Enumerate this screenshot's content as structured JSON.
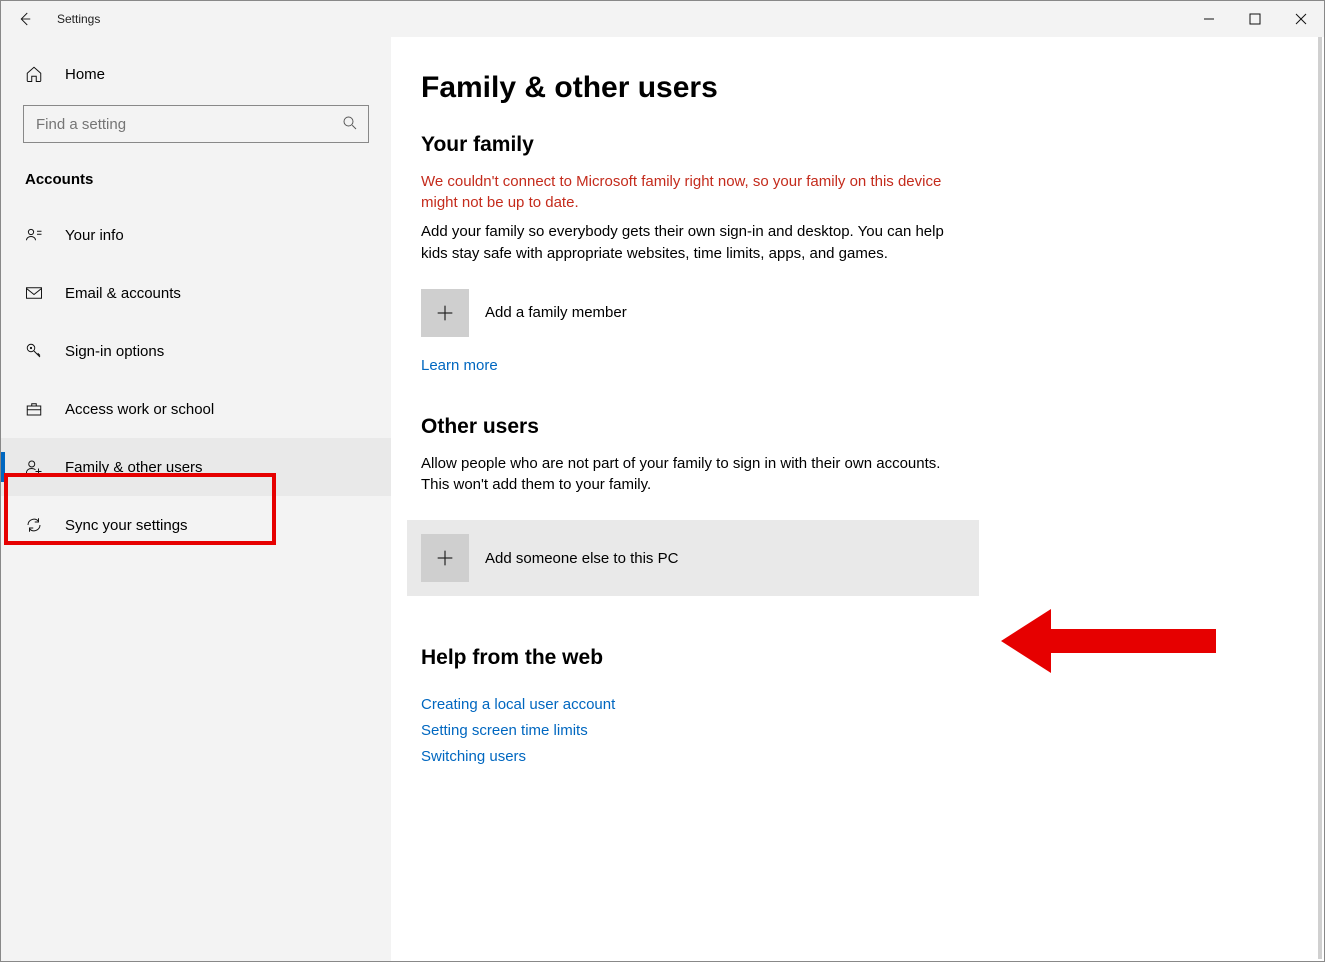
{
  "app": {
    "title": "Settings"
  },
  "sidebar": {
    "home_label": "Home",
    "search_placeholder": "Find a setting",
    "section_label": "Accounts",
    "items": [
      {
        "label": "Your info"
      },
      {
        "label": "Email & accounts"
      },
      {
        "label": "Sign-in options"
      },
      {
        "label": "Access work or school"
      },
      {
        "label": "Family & other users"
      },
      {
        "label": "Sync your settings"
      }
    ]
  },
  "main": {
    "page_title": "Family & other users",
    "family": {
      "heading": "Your family",
      "error": "We couldn't connect to Microsoft family right now, so your family on this device might not be up to date.",
      "body": "Add your family so everybody gets their own sign-in and desktop. You can help kids stay safe with appropriate websites, time limits, apps, and games.",
      "add_label": "Add a family member",
      "learn_more": "Learn more"
    },
    "other": {
      "heading": "Other users",
      "body": "Allow people who are not part of your family to sign in with their own accounts. This won't add them to your family.",
      "add_label": "Add someone else to this PC"
    },
    "help": {
      "heading": "Help from the web",
      "links": [
        "Creating a local user account",
        "Setting screen time limits",
        "Switching users"
      ]
    }
  }
}
